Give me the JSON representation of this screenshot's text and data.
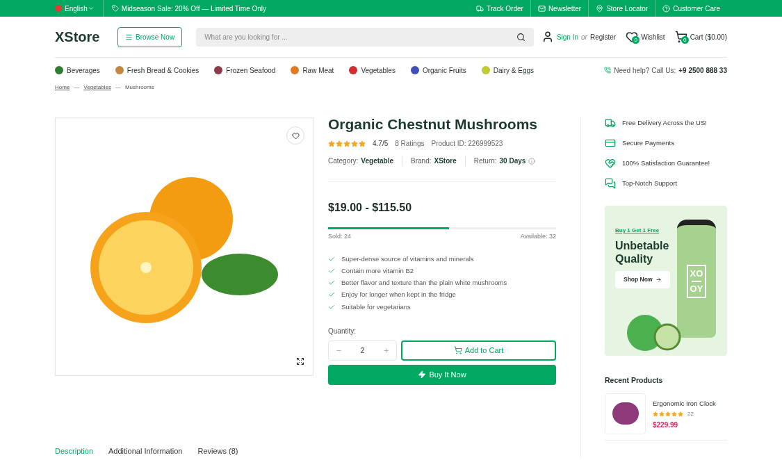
{
  "topbar": {
    "language": "English",
    "promo": "Midseason Sale: 20% Off — Limited Time Only",
    "links": [
      {
        "label": "Track Order",
        "kind": "truck"
      },
      {
        "label": "Newsletter",
        "kind": "mail"
      },
      {
        "label": "Store Locator",
        "kind": "pin"
      },
      {
        "label": "Customer Care",
        "kind": "help"
      }
    ]
  },
  "header": {
    "logo": "XStore",
    "browse": "Browse Now",
    "search_placeholder": "What are you looking for ...",
    "sign_in": "Sign In",
    "or": "or",
    "register": "Register",
    "wishlist": "Wishlist",
    "wishlist_count": "0",
    "cart": "Cart ($0.00)",
    "cart_count": "0"
  },
  "categories": [
    {
      "label": "Beverages",
      "color": "#2e7d32"
    },
    {
      "label": "Fresh Bread & Cookies",
      "color": "#c68642"
    },
    {
      "label": "Frozen Seafood",
      "color": "#8d3b4a"
    },
    {
      "label": "Raw Meat",
      "color": "#e07b1f"
    },
    {
      "label": "Vegetables",
      "color": "#d32f2f"
    },
    {
      "label": "Organic Fruits",
      "color": "#3f51b5"
    },
    {
      "label": "Dairy & Eggs",
      "color": "#c0ca33"
    }
  ],
  "help": {
    "label": "Need help? Call Us:",
    "phone": "+9 2500 888 33"
  },
  "breadcrumb_separator": "—",
  "breadcrumb": [
    {
      "label": "Home",
      "link": true
    },
    {
      "label": "Vegetables",
      "link": true
    },
    {
      "label": "Mushrooms",
      "link": false
    }
  ],
  "product": {
    "title": "Organic Chestnut Mushrooms",
    "stars": 5,
    "rating": "4.7/5",
    "ratings_count": "8 Ratings",
    "product_id": "Product ID: 226999523",
    "meta": [
      {
        "label": "Category:",
        "value": "Vegetable"
      },
      {
        "label": "Brand:",
        "value": "XStore"
      },
      {
        "label": "Return:",
        "value": "30 Days"
      }
    ],
    "price": "$19.00 - $115.50",
    "sold": "Sold: 24",
    "available": "Available: 32",
    "level": 0.53,
    "features": [
      "Super-dense source of vitamins and minerals",
      "Contain more vitamin B2",
      "Better flavor and texture than the plain white mushrooms",
      "Enjoy for longer when kept in the fridge",
      "Suitable for vegetarians"
    ],
    "quantity_label": "Quantity:",
    "quantity": "2",
    "add_to_cart": "Add to Cart",
    "buy_now": "Buy It Now"
  },
  "perks": [
    {
      "label": "Free Delivery Across the US!",
      "kind": "truck"
    },
    {
      "label": "Secure Payments",
      "kind": "card"
    },
    {
      "label": "100% Satisfaction Guarantee!",
      "kind": "heart"
    },
    {
      "label": "Top-Notch Support",
      "kind": "chat"
    }
  ],
  "promo_banner": {
    "tag": "Buy 1 Get 1 Free",
    "title": "Unbetable Quality",
    "button": "Shop Now",
    "bottle_label_top": "XO",
    "bottle_label_bottom": "OY"
  },
  "recent": {
    "title": "Recent Products",
    "items": [
      {
        "name": "Ergonomic Iron Clock",
        "stars": 5,
        "reviews": "22",
        "price": "$229.99"
      }
    ]
  },
  "tabs": [
    {
      "label": "Description",
      "selected": true
    },
    {
      "label": "Additional Information",
      "selected": false
    },
    {
      "label": "Reviews (8)",
      "selected": false
    }
  ]
}
